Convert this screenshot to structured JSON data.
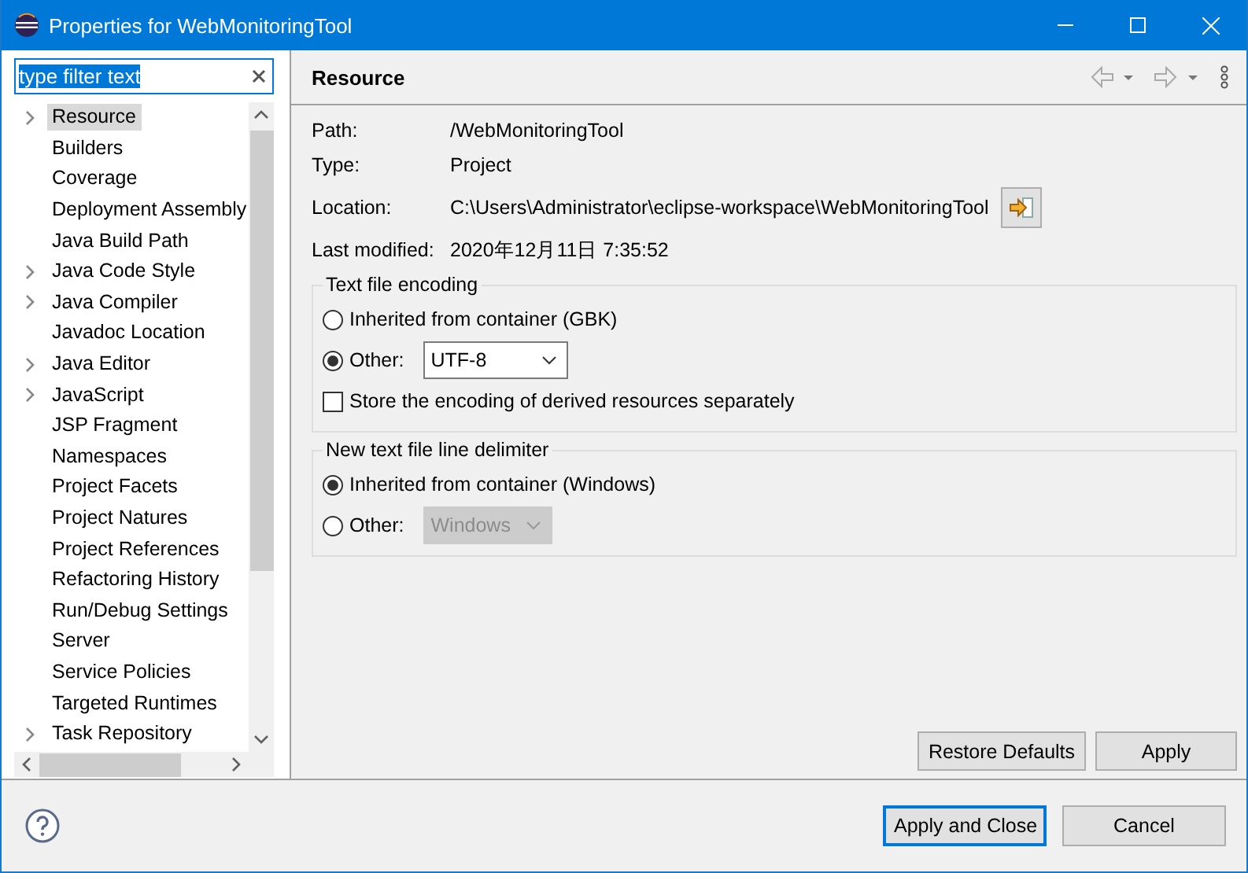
{
  "window": {
    "title": "Properties for WebMonitoringTool"
  },
  "filter": {
    "value": "type filter text"
  },
  "tree": [
    {
      "label": "Resource",
      "expandable": true,
      "selected": true
    },
    {
      "label": "Builders",
      "expandable": false,
      "selected": false
    },
    {
      "label": "Coverage",
      "expandable": false,
      "selected": false
    },
    {
      "label": "Deployment Assembly",
      "expandable": false,
      "selected": false
    },
    {
      "label": "Java Build Path",
      "expandable": false,
      "selected": false
    },
    {
      "label": "Java Code Style",
      "expandable": true,
      "selected": false
    },
    {
      "label": "Java Compiler",
      "expandable": true,
      "selected": false
    },
    {
      "label": "Javadoc Location",
      "expandable": false,
      "selected": false
    },
    {
      "label": "Java Editor",
      "expandable": true,
      "selected": false
    },
    {
      "label": "JavaScript",
      "expandable": true,
      "selected": false
    },
    {
      "label": "JSP Fragment",
      "expandable": false,
      "selected": false
    },
    {
      "label": "Namespaces",
      "expandable": false,
      "selected": false
    },
    {
      "label": "Project Facets",
      "expandable": false,
      "selected": false
    },
    {
      "label": "Project Natures",
      "expandable": false,
      "selected": false
    },
    {
      "label": "Project References",
      "expandable": false,
      "selected": false
    },
    {
      "label": "Refactoring History",
      "expandable": false,
      "selected": false
    },
    {
      "label": "Run/Debug Settings",
      "expandable": false,
      "selected": false
    },
    {
      "label": "Server",
      "expandable": false,
      "selected": false
    },
    {
      "label": "Service Policies",
      "expandable": false,
      "selected": false
    },
    {
      "label": "Targeted Runtimes",
      "expandable": false,
      "selected": false
    },
    {
      "label": "Task Repository",
      "expandable": true,
      "selected": false
    }
  ],
  "page": {
    "title": "Resource",
    "properties": [
      {
        "label": "Path:",
        "value": "/WebMonitoringTool"
      },
      {
        "label": "Type:",
        "value": "Project"
      },
      {
        "label": "Location:",
        "value": "C:\\Users\\Administrator\\eclipse-workspace\\WebMonitoringTool",
        "kind": "location"
      },
      {
        "label": "Last modified:",
        "value": "2020年12月11日 7:35:52"
      }
    ],
    "groups": [
      {
        "title": "Text file encoding",
        "options": [
          {
            "kind": "radio",
            "label": "Inherited from container (GBK)",
            "selected": false
          },
          {
            "kind": "radio-combo",
            "label": "Other:",
            "selected": true,
            "value": "UTF-8",
            "disabled": false
          },
          {
            "kind": "checkbox",
            "label": "Store the encoding of derived resources separately",
            "checked": false
          }
        ]
      },
      {
        "title": "New text file line delimiter",
        "options": [
          {
            "kind": "radio",
            "label": "Inherited from container (Windows)",
            "selected": true
          },
          {
            "kind": "radio-combo",
            "label": "Other:",
            "selected": false,
            "value": "Windows",
            "disabled": true
          }
        ]
      }
    ],
    "buttons": [
      "Restore Defaults",
      "Apply"
    ]
  },
  "footer": {
    "buttons": [
      {
        "label": "Apply and Close",
        "default": true
      },
      {
        "label": "Cancel",
        "default": false
      }
    ]
  }
}
